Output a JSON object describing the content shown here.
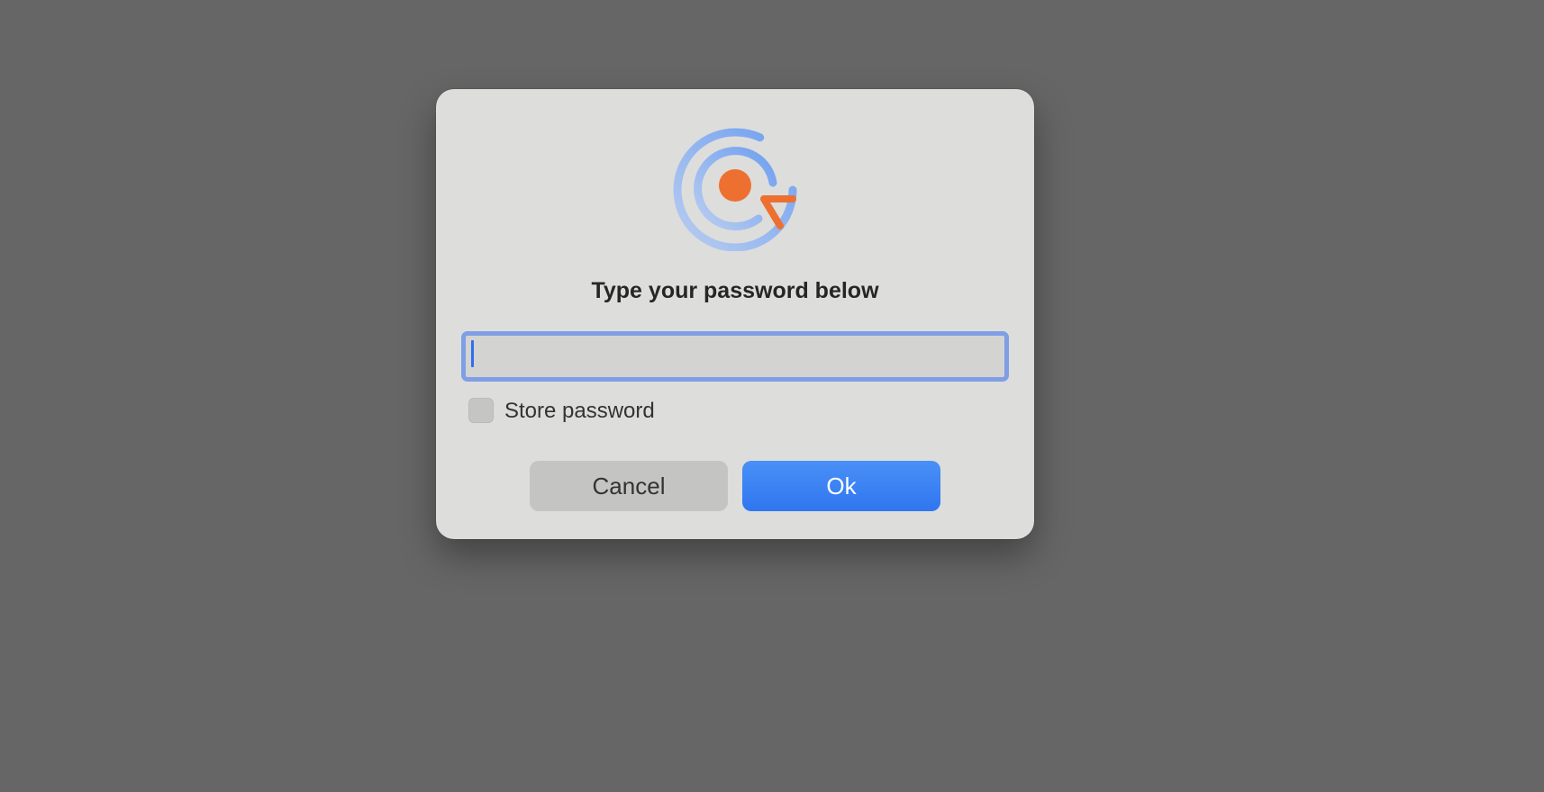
{
  "dialog": {
    "title": "Type your password below",
    "password_field": {
      "value": "",
      "placeholder": ""
    },
    "store_password": {
      "label": "Store password",
      "checked": false
    },
    "buttons": {
      "cancel_label": "Cancel",
      "ok_label": "Ok"
    },
    "logo_icon": "target-cursor-logo-icon"
  },
  "colors": {
    "backdrop": "#666666",
    "dialog_bg": "#dddddc",
    "accent_blue": "#3b82f6",
    "logo_orange": "#ee7030",
    "logo_blue": "#6f9ff0",
    "focus_ring": "#7f9ee6"
  }
}
